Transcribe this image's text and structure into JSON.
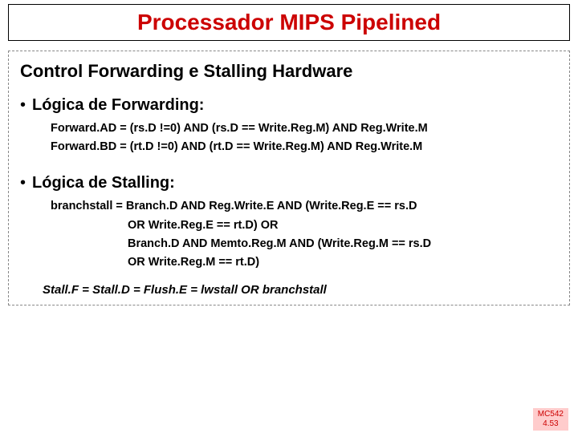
{
  "title": "Processador MIPS Pipelined",
  "subtitle": "Control Forwarding e Stalling Hardware",
  "forwarding": {
    "heading": "Lógica de Forwarding:",
    "lines": [
      "Forward.AD = (rs.D !=0) AND (rs.D == Write.Reg.M) AND Reg.Write.M",
      "Forward.BD = (rt.D !=0) AND (rt.D == Write.Reg.M) AND Reg.Write.M"
    ]
  },
  "stalling": {
    "heading": "Lógica de Stalling:",
    "line1": "branchstall = Branch.D AND Reg.Write.E AND (Write.Reg.E == rs.D",
    "line2": "OR Write.Reg.E == rt.D) OR",
    "line3": "Branch.D AND Memto.Reg.M AND (Write.Reg.M == rs.D",
    "line4": "OR Write.Reg.M == rt.D)"
  },
  "stall_eq": "Stall.F = Stall.D = Flush.E = lwstall OR branchstall",
  "footer": {
    "code": "MC542",
    "page": "4.53"
  }
}
